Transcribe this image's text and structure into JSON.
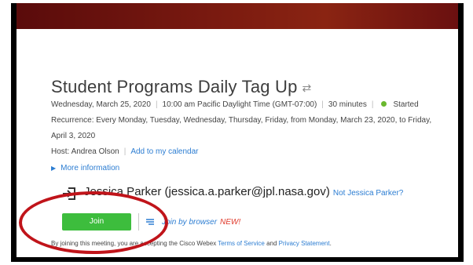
{
  "meeting": {
    "title": "Student Programs Daily Tag Up",
    "date": "Wednesday, March 25, 2020",
    "time": "10:00 am Pacific Daylight Time (GMT-07:00)",
    "duration": "30 minutes",
    "status": "Started",
    "recurrence_line1": "Recurrence: Every Monday, Tuesday, Wednesday, Thursday, Friday, from Monday, March 23, 2020, to Friday,",
    "recurrence_line2": "April 3, 2020",
    "host_label": "Host: Andrea Olson",
    "add_calendar": "Add to my calendar",
    "more_info": "More information"
  },
  "user": {
    "display": "Jessica Parker (jessica.a.parker@jpl.nasa.gov)",
    "not_user_link": "Not Jessica Parker?"
  },
  "actions": {
    "join_label": "Join",
    "join_browser_label": "Join by browser",
    "new_badge": "NEW!"
  },
  "legal": {
    "prefix": "By joining this meeting, you are accepting the Cisco Webex",
    "terms": "Terms of Service",
    "and": "and",
    "privacy": "Privacy Statement",
    "suffix": "."
  },
  "colors": {
    "banner": "#7a1a10",
    "join_button": "#3dbd3d",
    "link": "#2c7dd2",
    "status_dot": "#6ab82e",
    "annotation": "#c0141a"
  }
}
